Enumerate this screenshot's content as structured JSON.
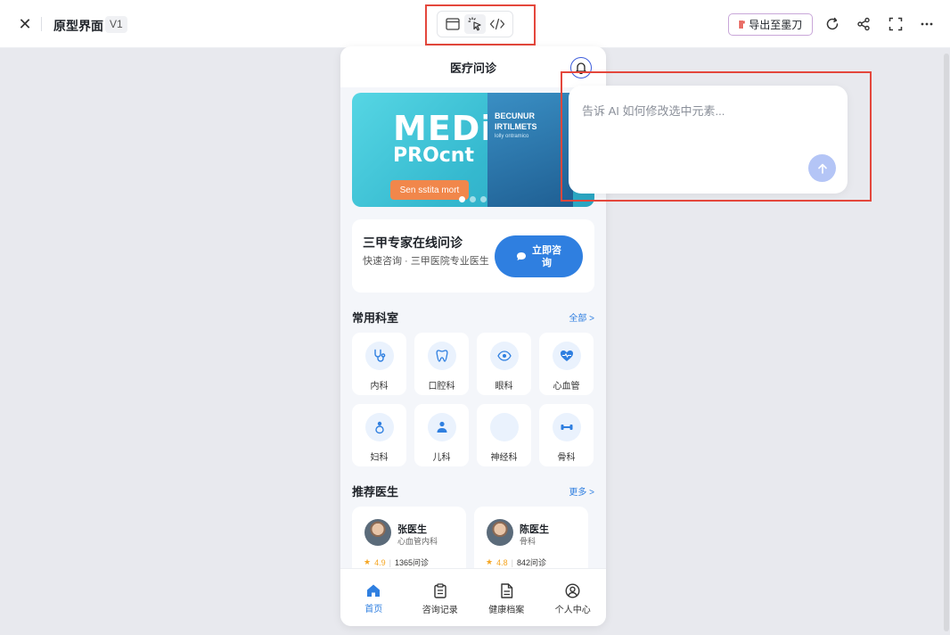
{
  "app": {
    "title": "原型界面",
    "version": "V1",
    "export_label": "导出至墨刀",
    "export_logo": "ll'"
  },
  "phone": {
    "header_title": "医疗问诊",
    "banner": {
      "big_text": "MEDi",
      "sub_text": "PROcnt",
      "card_title_1": "BECUNUR",
      "card_title_2": "IRTILMETS",
      "card_small": "lolly ontramico",
      "cta": "Sen sstita mort",
      "slide_count": 3,
      "active_slide": 1
    },
    "consult": {
      "title": "三甲专家在线问诊",
      "desc": "快速咨询 · 三甲医院专业医生",
      "button_label": "立即咨询"
    },
    "departments": {
      "title": "常用科室",
      "more": "全部 >",
      "items": [
        {
          "label": "内科",
          "icon": "stethoscope-icon"
        },
        {
          "label": "口腔科",
          "icon": "tooth-icon"
        },
        {
          "label": "眼科",
          "icon": "eye-icon"
        },
        {
          "label": "心血管",
          "icon": "heart-pulse-icon"
        },
        {
          "label": "妇科",
          "icon": "female-icon"
        },
        {
          "label": "儿科",
          "icon": "child-icon"
        },
        {
          "label": "神经科",
          "icon": "none"
        },
        {
          "label": "骨科",
          "icon": "bone-icon"
        }
      ]
    },
    "doctors": {
      "title": "推荐医生",
      "more": "更多 >",
      "items": [
        {
          "name": "张医生",
          "dept": "心血管内科",
          "rating": "4.9",
          "consults": "1365问诊"
        },
        {
          "name": "陈医生",
          "dept": "骨科",
          "rating": "4.8",
          "consults": "842问诊"
        }
      ]
    },
    "tabs": [
      {
        "label": "首页",
        "icon": "home-icon",
        "active": true
      },
      {
        "label": "咨询记录",
        "icon": "clipboard-icon",
        "active": false
      },
      {
        "label": "健康档案",
        "icon": "document-icon",
        "active": false
      },
      {
        "label": "个人中心",
        "icon": "user-circle-icon",
        "active": false
      }
    ]
  },
  "ai_panel": {
    "placeholder": "告诉 AI 如何修改选中元素..."
  },
  "colors": {
    "accent": "#2f7fe0",
    "highlight_box": "#e4473c",
    "send_button": "#b4c5f6"
  }
}
